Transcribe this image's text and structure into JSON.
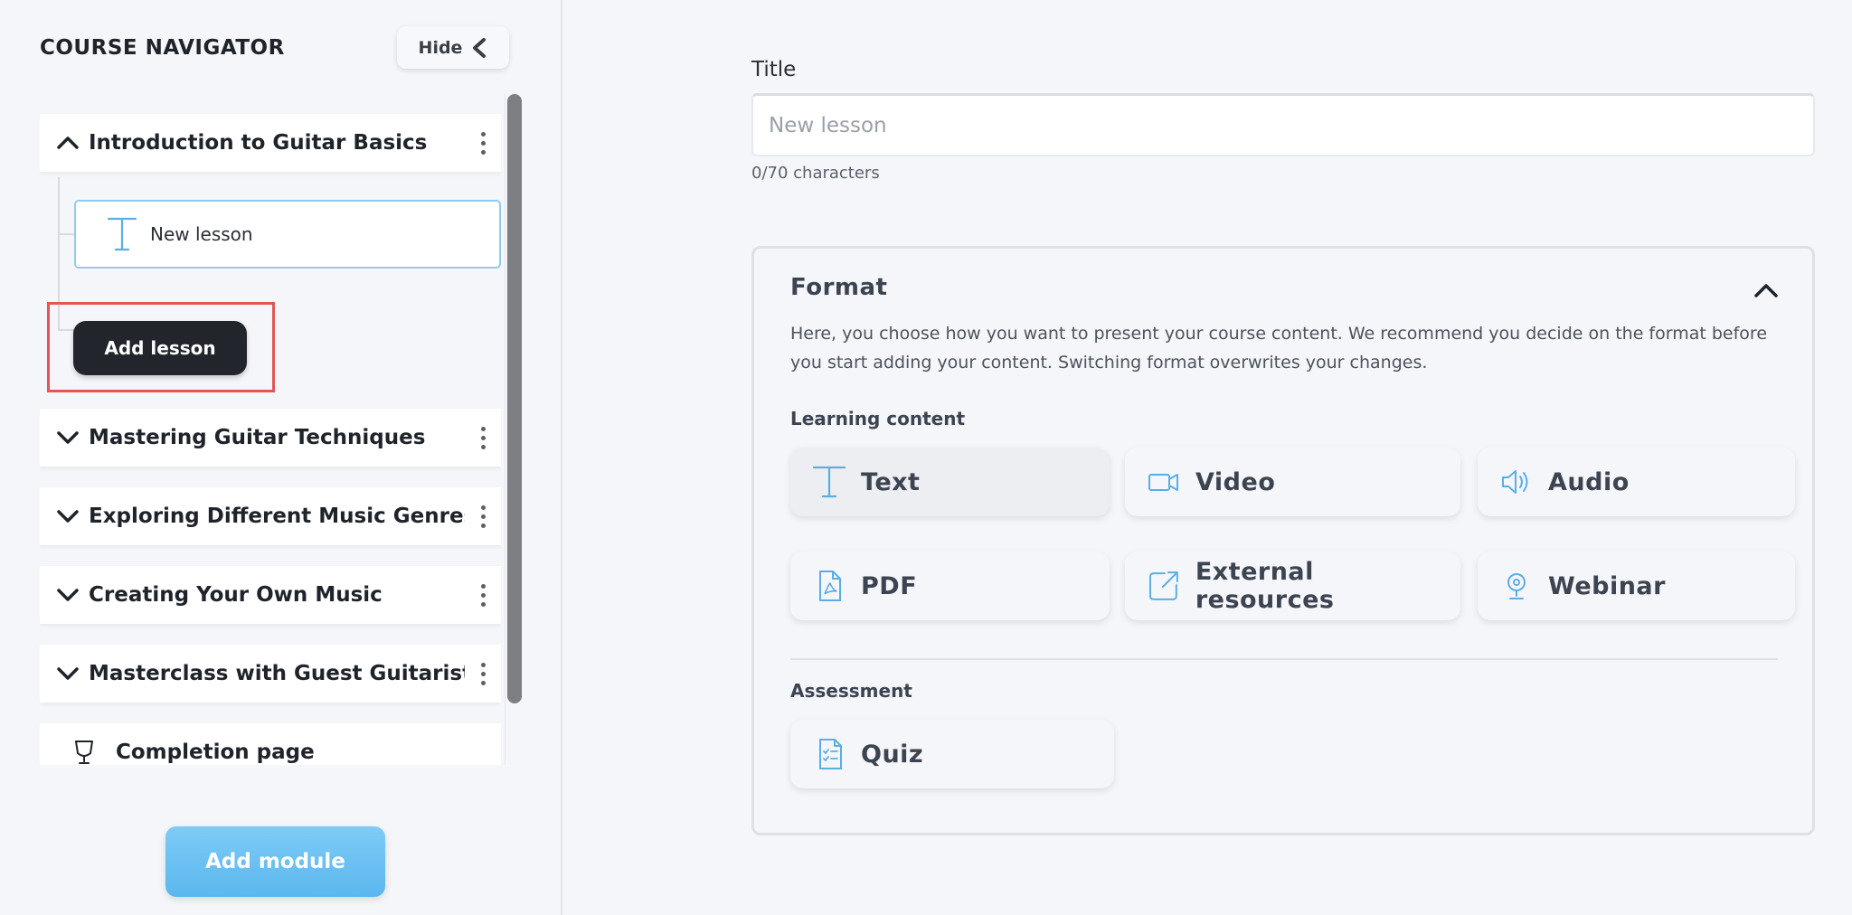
{
  "sidebar": {
    "title": "COURSE NAVIGATOR",
    "hide_label": "Hide",
    "modules": [
      {
        "label": "Introduction to Guitar Basics",
        "expanded": true
      },
      {
        "label": "Mastering Guitar Techniques",
        "expanded": false
      },
      {
        "label": "Exploring Different Music Genres",
        "expanded": false
      },
      {
        "label": "Creating Your Own Music",
        "expanded": false
      },
      {
        "label": "Masterclass with Guest Guitarists",
        "expanded": false
      }
    ],
    "lesson": {
      "label": "New lesson",
      "icon": "text-icon"
    },
    "add_lesson_label": "Add lesson",
    "completion_label": "Completion page",
    "add_module_label": "Add module"
  },
  "main": {
    "title_label": "Title",
    "title_placeholder": "New lesson",
    "title_value": "",
    "char_count": "0/70 characters",
    "format": {
      "heading": "Format",
      "description": "Here, you choose how you want to present your course content. We recommend you decide on the format before you start adding your content. Switching format overwrites your changes.",
      "learning_label": "Learning content",
      "learning_options": [
        {
          "label": "Text",
          "icon": "text-icon",
          "selected": true
        },
        {
          "label": "Video",
          "icon": "video-icon",
          "selected": false
        },
        {
          "label": "Audio",
          "icon": "audio-icon",
          "selected": false
        },
        {
          "label": "PDF",
          "icon": "pdf-icon",
          "selected": false
        },
        {
          "label": "External resources",
          "icon": "external-link-icon",
          "selected": false
        },
        {
          "label": "Webinar",
          "icon": "webinar-icon",
          "selected": false
        }
      ],
      "assessment_label": "Assessment",
      "assessment_options": [
        {
          "label": "Quiz",
          "icon": "quiz-icon"
        }
      ]
    }
  },
  "colors": {
    "accent": "#5ab7ee",
    "icon_blue": "#5aaee6",
    "dark_button": "#22262c",
    "highlight": "#e05757"
  }
}
